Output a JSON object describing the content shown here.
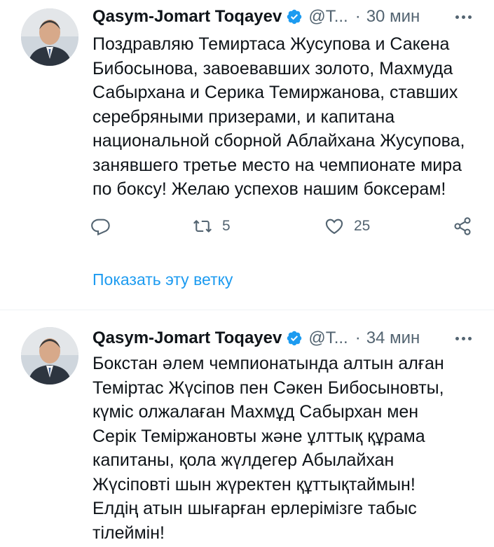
{
  "tweets": [
    {
      "author": "Qasym-Jomart Toqayev",
      "handle": "@T...",
      "separator": "·",
      "time": "30 мин",
      "text": "Поздравляю Темиртаса Жусупова и Сакена\nБибосынова, завоевавших золото, Махмуда\nСабырхана и Серика Темиржанова, ставших\nсеребряными призерами, и капитана\nнациональной сборной Аблайхана Жусупова,\nзанявшего третье место на чемпионате мира\nпо боксу! Желаю успехов нашим боксерам!",
      "retweets": "5",
      "likes": "25",
      "show_thread": "Показать эту ветку"
    },
    {
      "author": "Qasym-Jomart Toqayev",
      "handle": "@T...",
      "separator": "·",
      "time": "34 мин",
      "text": "Бокстан әлем чемпионатында алтын алған\nТеміртас Жүсіпов пен Сәкен Бибосыновты,\nкүміс олжалаған Махмұд Сабырхан мен\nСерік Теміржановты және ұлттық құрама\nкапитаны, қола жүлдегер Абылайхан\nЖүсіповті шын жүректен құттықтаймын!\nЕлдің атын шығарған ерлерімізге табыс\nтілеймін!"
    }
  ],
  "colors": {
    "text": "#0f1419",
    "secondary": "#536471",
    "accent": "#1d9bf0",
    "divider": "#eff3f4"
  },
  "icons": [
    "verified-badge-icon",
    "more-icon",
    "reply-icon",
    "retweet-icon",
    "like-icon",
    "share-icon"
  ]
}
